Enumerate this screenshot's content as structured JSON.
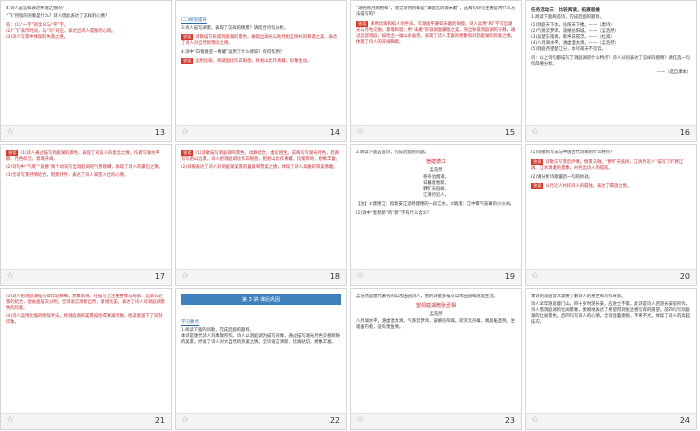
{
  "slides": [
    {
      "num": "13",
      "title": "4.诗人是怎样表达失落之感的？"
    },
    {
      "num": "14",
      "title": "(二)探究提升"
    },
    {
      "num": "15",
      "title": "“湖光秋月两相和”，而全诗用的却是“潭面无风镜未磨”，这两句诗句主要是用什么方法描写的？"
    },
    {
      "num": "16",
      "title": "任务活动三　比较阅读，拓展思维"
    },
    {
      "num": "17",
      "title": "答案 (1)《洞庭湖》的诗人通过描写洞庭湖的景色，表现对友人的思念。"
    },
    {
      "num": "18",
      "title": "答案 诗歌通过描写自然景物，表达诗人内心的情感。"
    },
    {
      "num": "19",
      "title": "2.阅读下面这首诗，完成后面的问题。",
      "subtitle": "宿建德江",
      "author": "孟浩然"
    },
    {
      "num": "20",
      "title": "(1)诗歌的写法与中国古代诗歌的什么特点？"
    },
    {
      "num": "21",
      "title": "(3)诗人把洞庭湖描写得比较精细，想象新奇。"
    },
    {
      "num": "22",
      "banner": "第 3 讲 课后巩固",
      "subtitle": "学习要点"
    },
    {
      "num": "23",
      "title": "望洞庭湖赠张丞相",
      "author": "孟浩然"
    },
    {
      "num": "24",
      "title": "本诗的深层含义需要了解诗人的身世和写作背景。"
    }
  ],
  "labels": {
    "answer": "答案",
    "analysis": "解析"
  },
  "colors": {
    "accent": "#2d7bb6",
    "red": "#c0262d",
    "blue": "#2d69a8"
  }
}
